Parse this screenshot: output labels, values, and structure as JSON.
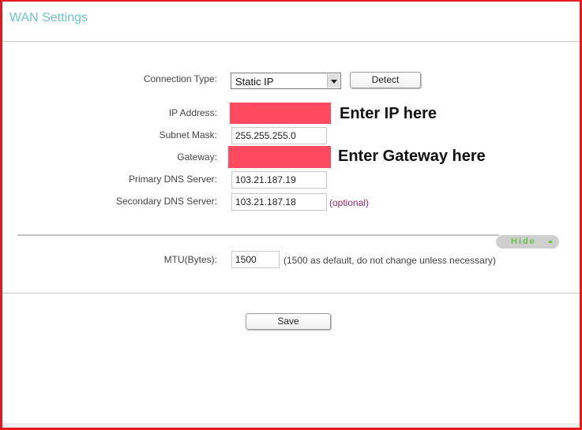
{
  "page": {
    "title": "WAN Settings"
  },
  "form": {
    "connection_type": {
      "label": "Connection Type:",
      "selected": "Static IP",
      "detect_label": "Detect"
    },
    "ip_address": {
      "label": "IP Address:",
      "value": "",
      "annotation": "Enter IP here",
      "redaction_color": "#fe4a5e"
    },
    "subnet_mask": {
      "label": "Subnet Mask:",
      "value": "255.255.255.0"
    },
    "gateway": {
      "label": "Gateway:",
      "value": "",
      "annotation": "Enter Gateway here",
      "redaction_color": "#fe4a5e"
    },
    "primary_dns": {
      "label": "Primary DNS Server:",
      "value": "103.21.187.19"
    },
    "secondary_dns": {
      "label": "Secondary DNS Server:",
      "value": "103.21.187.18",
      "note": "(optional)"
    },
    "advanced_toggle": {
      "label": "Hide",
      "state": "expanded"
    },
    "mtu": {
      "label": "MTU(Bytes):",
      "value": "1500",
      "hint": "(1500 as default, do not change unless necessary)"
    },
    "save_label": "Save"
  },
  "colors": {
    "title": "#6cc3cd",
    "frame": "#e41a1c",
    "toggle_text": "#6cc04a",
    "optional_text": "#9b2a6a"
  }
}
